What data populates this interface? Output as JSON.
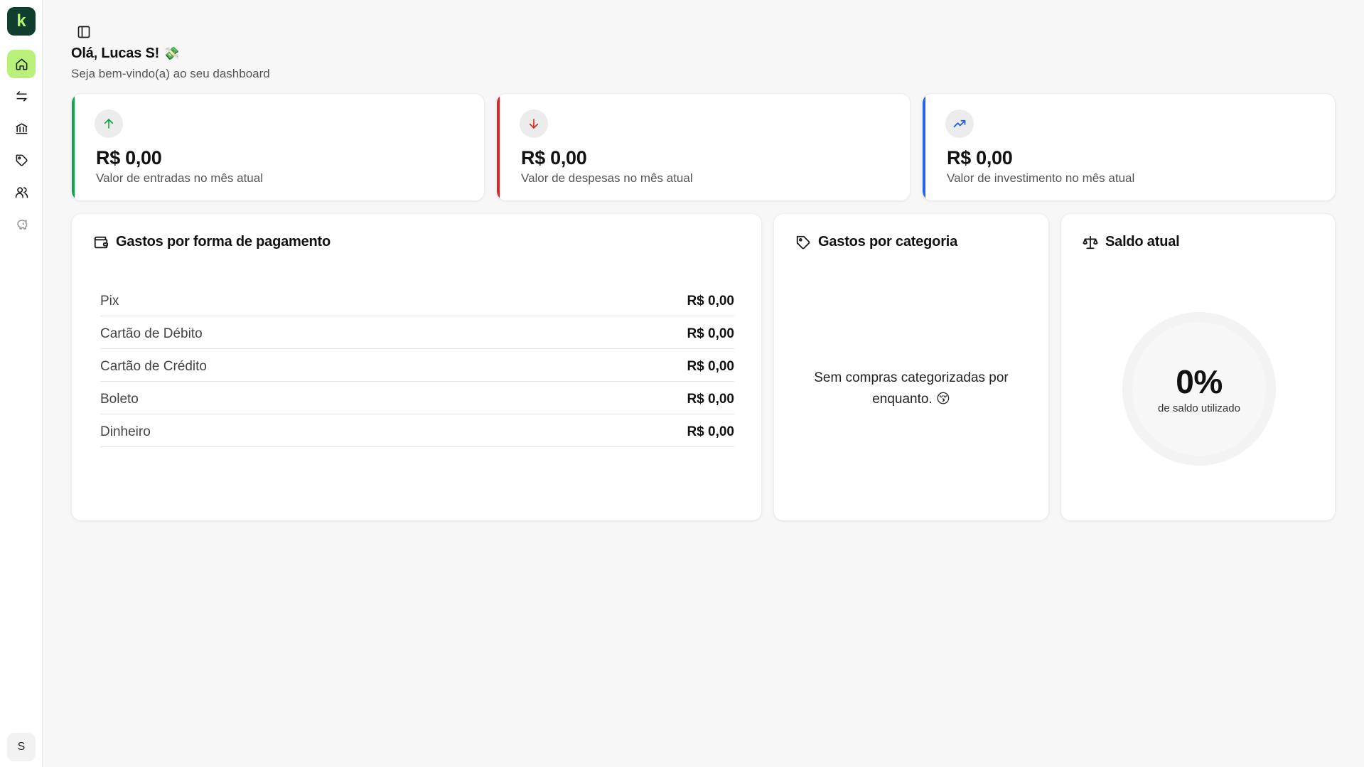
{
  "brand": {
    "logo_letter": "k"
  },
  "sidebar": {
    "items": [
      {
        "name": "home",
        "icon": "home-icon",
        "active": true
      },
      {
        "name": "transactions",
        "icon": "arrows-left-right-icon",
        "active": false
      },
      {
        "name": "banks",
        "icon": "bank-icon",
        "active": false
      },
      {
        "name": "categories",
        "icon": "tag-icon",
        "active": false
      },
      {
        "name": "users",
        "icon": "users-icon",
        "active": false
      },
      {
        "name": "savings",
        "icon": "piggy-bank-icon",
        "active": false
      }
    ],
    "avatar_initial": "S"
  },
  "header": {
    "greeting": "Olá, Lucas S!",
    "greeting_emoji": "💸",
    "subtitle": "Seja bem-vindo(a) ao seu dashboard"
  },
  "stats": [
    {
      "value": "R$ 0,00",
      "label": "Valor de entradas no mês atual",
      "color": "#16a34a",
      "icon": "arrow-up-icon"
    },
    {
      "value": "R$ 0,00",
      "label": "Valor de despesas no mês atual",
      "color": "#dc2626",
      "icon": "arrow-down-icon"
    },
    {
      "value": "R$ 0,00",
      "label": "Valor de investimento no mês atual",
      "color": "#2563eb",
      "icon": "trending-up-icon"
    }
  ],
  "payment_panel": {
    "title": "Gastos por forma de pagamento",
    "icon": "wallet-icon",
    "rows": [
      {
        "name": "Pix",
        "amount": "R$ 0,00"
      },
      {
        "name": "Cartão de Débito",
        "amount": "R$ 0,00"
      },
      {
        "name": "Cartão de Crédito",
        "amount": "R$ 0,00"
      },
      {
        "name": "Boleto",
        "amount": "R$ 0,00"
      },
      {
        "name": "Dinheiro",
        "amount": "R$ 0,00"
      }
    ]
  },
  "category_panel": {
    "title": "Gastos por categoria",
    "icon": "tag-icon",
    "empty_message": "Sem compras categorizadas por enquanto.",
    "empty_emoji": "😚"
  },
  "balance_panel": {
    "title": "Saldo atual",
    "icon": "scale-icon",
    "percent": "0%",
    "percent_label": "de saldo utilizado"
  }
}
